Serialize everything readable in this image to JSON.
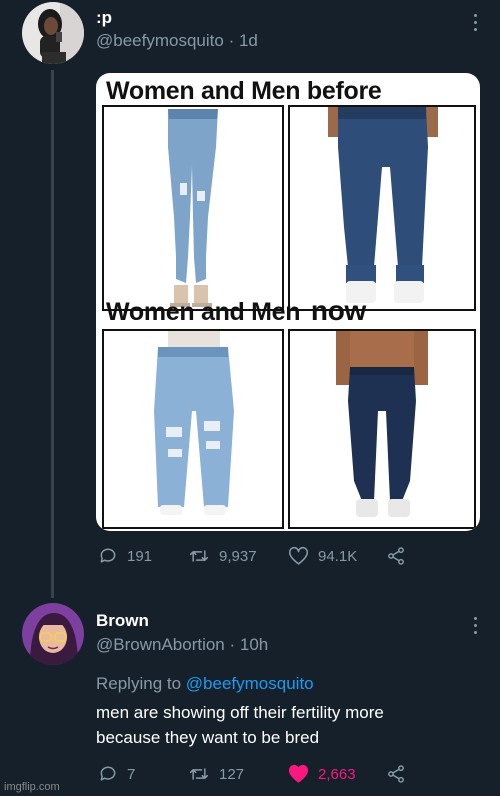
{
  "tweet1": {
    "name": ":p",
    "handle": "@beefymosquito",
    "time": "1d",
    "media": {
      "heading_top": "Women and Men before",
      "heading_bottom_prefix": "Women and Men",
      "heading_bottom_suffix": "now"
    },
    "actions": {
      "replies": "191",
      "retweets": "9,937",
      "likes": "94.1K"
    }
  },
  "tweet2": {
    "name": "Brown",
    "handle": "@BrownAbortion",
    "time": "10h",
    "replying_prefix": "Replying to",
    "replying_mention": "@beefymosquito",
    "text_line1": "men are showing off their fertility more",
    "text_line2": "because they want to be bred",
    "actions": {
      "replies": "7",
      "retweets": "127",
      "likes": "2,663",
      "liked": true
    }
  },
  "watermark": "imgflip.com",
  "colors": {
    "background": "#15202b",
    "secondary_text": "#8899a6",
    "accent_blue": "#1d9bf0",
    "like_pink": "#f91880"
  },
  "icons": [
    "comment-icon",
    "retweet-icon",
    "heart-icon",
    "share-icon",
    "more-icon"
  ]
}
